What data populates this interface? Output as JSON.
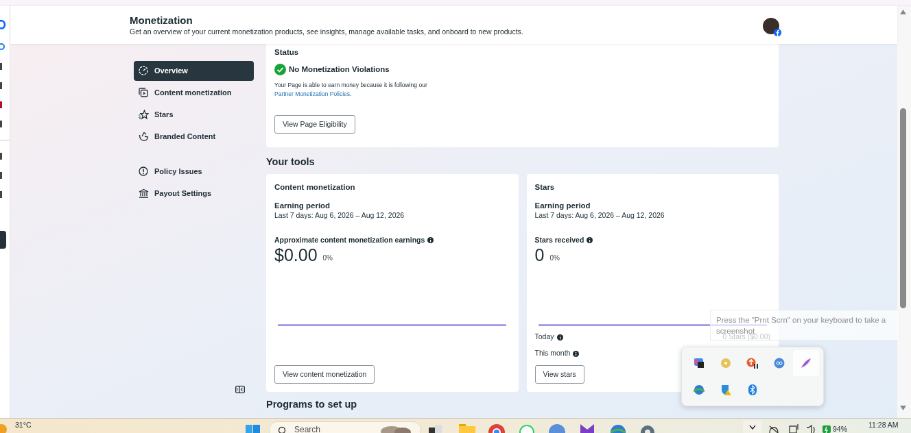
{
  "header": {
    "title": "Monetization",
    "subtitle": "Get an overview of your current monetization products, see insights, manage available tasks, and onboard to new products."
  },
  "nav": {
    "sections": [
      {
        "items": [
          {
            "label": "Overview",
            "kind": "gauge",
            "selected": true
          },
          {
            "label": "Content monetization",
            "kind": "play",
            "selected": false
          },
          {
            "label": "Stars",
            "kind": "star",
            "selected": false
          },
          {
            "label": "Branded Content",
            "kind": "branded",
            "selected": false
          }
        ]
      },
      {
        "items": [
          {
            "label": "Policy Issues",
            "kind": "alert",
            "selected": false
          },
          {
            "label": "Payout Settings",
            "kind": "bank",
            "selected": false
          }
        ]
      }
    ]
  },
  "status_card": {
    "title": "Status",
    "heading": "No Monetization Violations",
    "text": "Your Page is able to earn money because it is following our",
    "link": "Partner Monetization Policies",
    "link_suffix": ".",
    "button": "View Page Eligibility"
  },
  "tools_heading": "Your tools",
  "tools": [
    {
      "title": "Content monetization",
      "period_label": "Earning period",
      "period": "Last 7 days: Aug 6, 2026 – Aug 12, 2026",
      "metric_label": "Approximate content monetization earnings",
      "value": "$0.00",
      "change": "0%",
      "button": "View content monetization"
    },
    {
      "title": "Stars",
      "period_label": "Earning period",
      "period": "Last 7 days: Aug 6, 2026 – Aug 12, 2026",
      "metric_label": "Stars received",
      "value": "0",
      "change": "0%",
      "rows": [
        {
          "label": "Today",
          "value": "0 Stars ($0.00)"
        },
        {
          "label": "This month"
        }
      ],
      "button": "View stars"
    }
  ],
  "programs_heading": "Programs to set up",
  "tooltip": "Press the \"Prnt Scrn\" on your keyboard to take a screenshot",
  "taskbar": {
    "temperature": "31°C",
    "search_placeholder": "Search",
    "battery": "94%",
    "time": "11:28 AM"
  }
}
